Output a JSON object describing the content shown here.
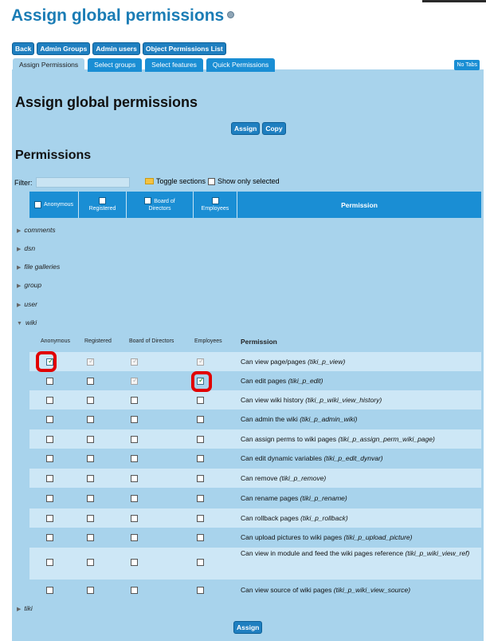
{
  "page_title": "Assign global permissions",
  "nav_buttons": {
    "back": "Back",
    "admin_groups": "Admin Groups",
    "admin_users": "Admin users",
    "object_perms": "Object Permissions List"
  },
  "tabs": {
    "assign": "Assign Permissions",
    "groups": "Select groups",
    "features": "Select features",
    "quick": "Quick Permissions",
    "no_tabs": "No Tabs"
  },
  "section_heading": "Assign global permissions",
  "actions": {
    "assign": "Assign",
    "copy": "Copy"
  },
  "permissions_heading": "Permissions",
  "filter": {
    "label": "Filter:",
    "value": "",
    "toggle_sections": "Toggle sections",
    "show_only_selected": "Show only selected"
  },
  "header": {
    "anonymous": "Anonymous",
    "registered": "Registered",
    "board_line1": "Board of",
    "board_line2": "Directors",
    "employees": "Employees",
    "permission": "Permission"
  },
  "sections": {
    "comments": "comments",
    "dsn": "dsn",
    "file_galleries": "file galleries",
    "group": "group",
    "user": "user",
    "wiki": "wiki",
    "tiki": "tiki"
  },
  "wiki_header": {
    "anonymous": "Anonymous",
    "registered": "Registered",
    "board": "Board of Directors",
    "employees": "Employees",
    "permission": "Permission"
  },
  "wiki_perms": [
    {
      "label": "Can view page/pages",
      "code": "(tiki_p_view)",
      "checks": [
        "checked",
        "dim",
        "dim",
        "dim"
      ]
    },
    {
      "label": "Can edit pages",
      "code": "(tiki_p_edit)",
      "checks": [
        "empty",
        "empty",
        "dim",
        "checked"
      ]
    },
    {
      "label": "Can view wiki history",
      "code": "(tiki_p_wiki_view_history)",
      "checks": [
        "empty",
        "empty",
        "empty",
        "empty"
      ]
    },
    {
      "label": "Can admin the wiki",
      "code": "(tiki_p_admin_wiki)",
      "checks": [
        "empty",
        "empty",
        "empty",
        "empty"
      ]
    },
    {
      "label": "Can assign perms to wiki pages",
      "code": "(tiki_p_assign_perm_wiki_page)",
      "checks": [
        "empty",
        "empty",
        "empty",
        "empty"
      ]
    },
    {
      "label": "Can edit dynamic variables",
      "code": "(tiki_p_edit_dynvar)",
      "checks": [
        "empty",
        "empty",
        "empty",
        "empty"
      ]
    },
    {
      "label": "Can remove",
      "code": "(tiki_p_remove)",
      "checks": [
        "empty",
        "empty",
        "empty",
        "empty"
      ]
    },
    {
      "label": "Can rename pages",
      "code": "(tiki_p_rename)",
      "checks": [
        "empty",
        "empty",
        "empty",
        "empty"
      ]
    },
    {
      "label": "Can rollback pages",
      "code": "(tiki_p_rollback)",
      "checks": [
        "empty",
        "empty",
        "empty",
        "empty"
      ]
    },
    {
      "label": "Can upload pictures to wiki pages",
      "code": "(tiki_p_upload_picture)",
      "checks": [
        "empty",
        "empty",
        "empty",
        "empty"
      ]
    },
    {
      "label": "Can view in module and feed the wiki pages reference",
      "code": "(tiki_p_wiki_view_ref)",
      "checks": [
        "empty",
        "empty",
        "empty",
        "empty"
      ]
    },
    {
      "label": "Can view source of wiki pages",
      "code": "(tiki_p_wiki_view_source)",
      "checks": [
        "empty",
        "empty",
        "empty",
        "empty"
      ]
    }
  ]
}
